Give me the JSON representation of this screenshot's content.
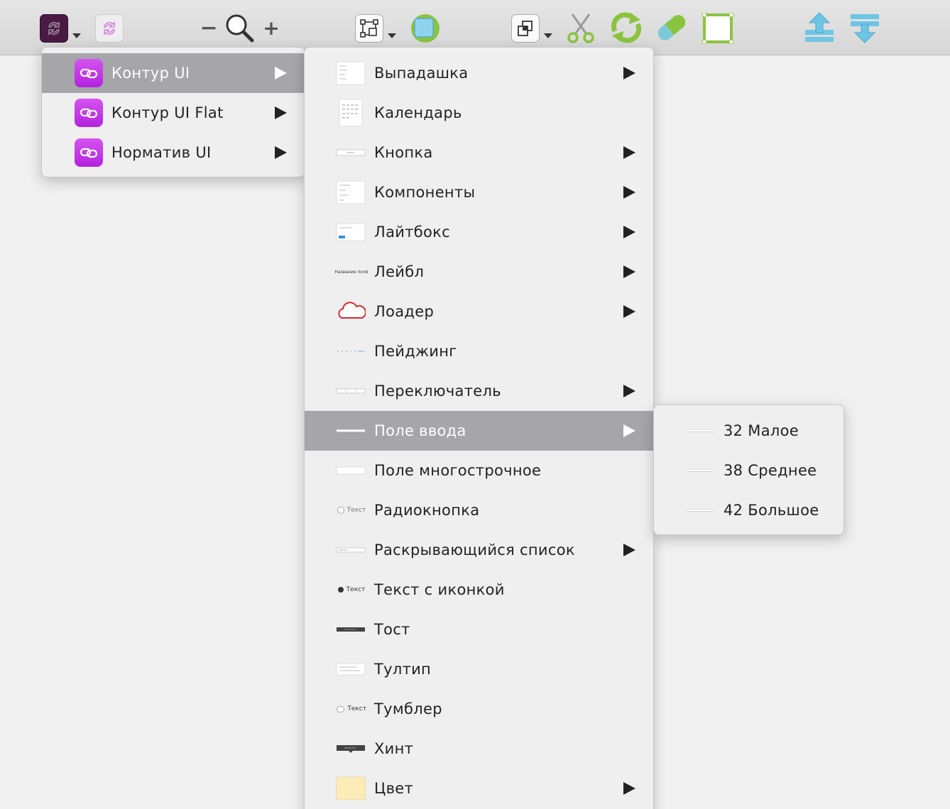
{
  "colors": {
    "highlight": "#a5a5aa",
    "menu_bg": "#efefef",
    "lib_icon": "#c73ae9",
    "accent_green": "#8ac43f",
    "accent_blue": "#6ec6e6"
  },
  "toolbar": {
    "icons": [
      "library-sync-icon",
      "library-sync-disabled-icon",
      "zoom-out-icon",
      "magnifier-icon",
      "zoom-in-icon",
      "bounding-box-icon",
      "shape-icon",
      "arrange-icon",
      "scissors-icon",
      "rotate-icon",
      "pill-icon",
      "frame-icon",
      "move-up-icon",
      "move-down-icon"
    ],
    "zoom_minus": "−",
    "zoom_plus": "+"
  },
  "libraries": [
    {
      "label": "Контур UI",
      "highlighted": true
    },
    {
      "label": "Контур UI Flat",
      "highlighted": false
    },
    {
      "label": "Норматив UI",
      "highlighted": false
    }
  ],
  "components": [
    {
      "label": "Выпадашка",
      "thumb": "dropdown-thumb-icon",
      "submenu": true
    },
    {
      "label": "Календарь",
      "thumb": "calendar-thumb-icon",
      "submenu": false
    },
    {
      "label": "Кнопка",
      "thumb": "button-thumb-icon",
      "submenu": true
    },
    {
      "label": "Компоненты",
      "thumb": "components-thumb-icon",
      "submenu": true
    },
    {
      "label": "Лайтбокс",
      "thumb": "lightbox-thumb-icon",
      "submenu": true
    },
    {
      "label": "Лейбл",
      "thumb": "label-thumb-icon",
      "submenu": true,
      "thumb_text": "Название поля"
    },
    {
      "label": "Лоадер",
      "thumb": "cloud-loader-icon",
      "submenu": true
    },
    {
      "label": "Пейджинг",
      "thumb": "paging-thumb-icon",
      "submenu": false
    },
    {
      "label": "Переключатель",
      "thumb": "switcher-thumb-icon",
      "submenu": true
    },
    {
      "label": "Поле ввода",
      "thumb": "input-thumb-icon",
      "submenu": true,
      "highlighted": true
    },
    {
      "label": "Поле многострочное",
      "thumb": "textarea-thumb-icon",
      "submenu": false
    },
    {
      "label": "Радиокнопка",
      "thumb": "radio-thumb-icon",
      "submenu": false,
      "thumb_text": "Текст"
    },
    {
      "label": "Раскрывающийся список",
      "thumb": "select-thumb-icon",
      "submenu": true
    },
    {
      "label": "Текст с иконкой",
      "thumb": "text-icon-thumb-icon",
      "submenu": false,
      "thumb_text": "Текст"
    },
    {
      "label": "Тост",
      "thumb": "toast-thumb-icon",
      "submenu": false
    },
    {
      "label": "Тултип",
      "thumb": "tooltip-thumb-icon",
      "submenu": false
    },
    {
      "label": "Тумблер",
      "thumb": "toggle-thumb-icon",
      "submenu": false,
      "thumb_text": "Текст"
    },
    {
      "label": "Хинт",
      "thumb": "hint-thumb-icon",
      "submenu": false
    },
    {
      "label": "Цвет",
      "thumb": "color-thumb-icon",
      "submenu": true
    }
  ],
  "sizes": [
    {
      "label": "32 Малое"
    },
    {
      "label": "38 Среднее"
    },
    {
      "label": "42 Большое"
    }
  ]
}
